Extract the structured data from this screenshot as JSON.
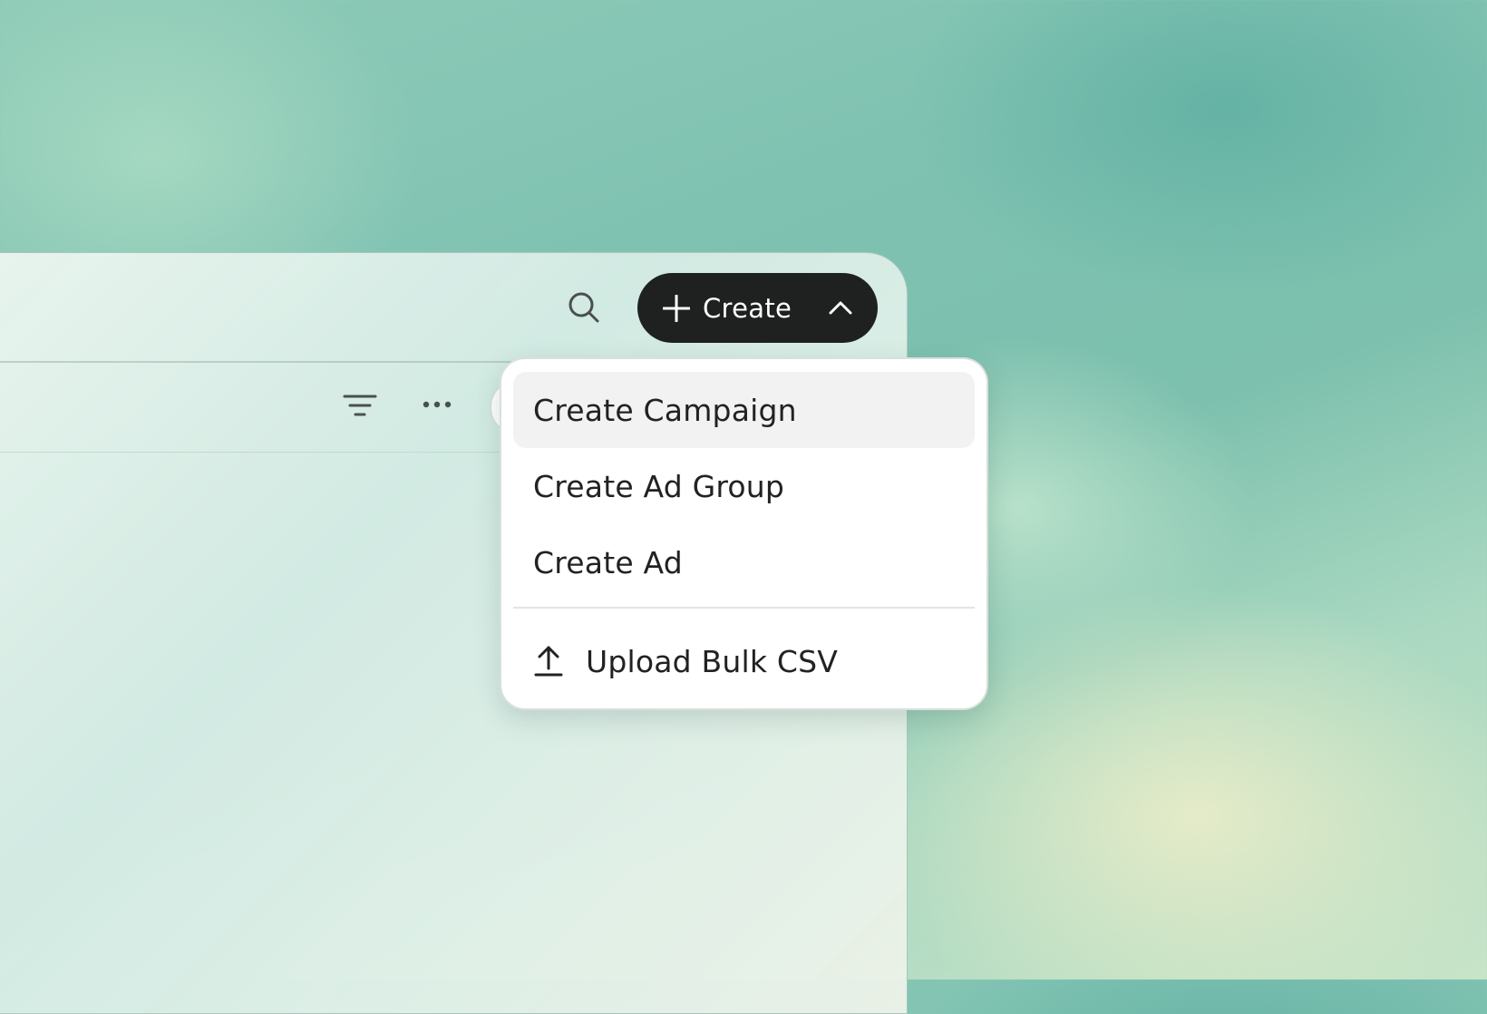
{
  "header": {
    "search_icon": "search-icon",
    "create_button": {
      "label": "Create",
      "icon": "plus-icon",
      "toggle_icon": "chevron-up-icon",
      "expanded": true
    }
  },
  "toolbar": {
    "filter_icon": "filter-icon",
    "more_icon": "more-horizontal-icon"
  },
  "create_menu": {
    "items": [
      {
        "label": "Create Campaign",
        "highlighted": true
      },
      {
        "label": "Create Ad Group",
        "highlighted": false
      },
      {
        "label": "Create Ad",
        "highlighted": false
      }
    ],
    "upload": {
      "label": "Upload Bulk CSV",
      "icon": "upload-icon"
    }
  },
  "colors": {
    "button_bg": "#1f2121",
    "menu_bg": "#ffffff",
    "highlight_bg": "#f2f2f2",
    "text": "#222222"
  }
}
